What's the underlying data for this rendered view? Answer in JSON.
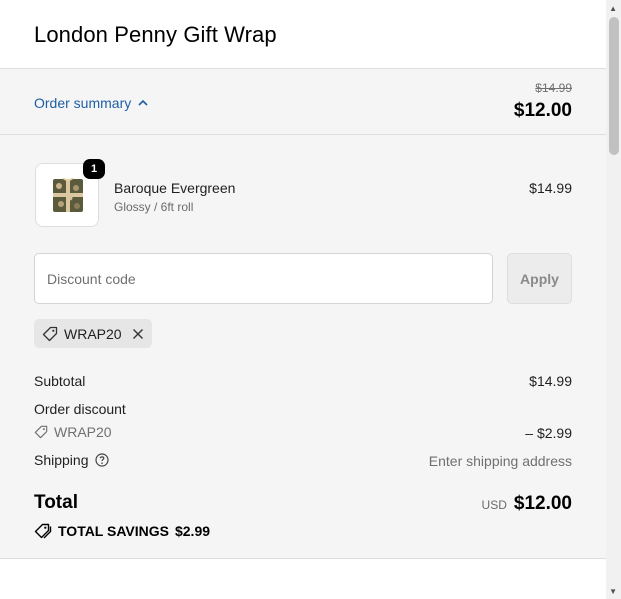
{
  "header": {
    "shop_name": "London Penny Gift Wrap"
  },
  "summary": {
    "toggle_label": "Order summary",
    "original_price": "$14.99",
    "price": "$12.00"
  },
  "product": {
    "quantity": "1",
    "name": "Baroque Evergreen",
    "variant": "Glossy / 6ft roll",
    "price": "$14.99",
    "image_icon": "gift-box-icon"
  },
  "discount": {
    "placeholder": "Discount code",
    "apply_label": "Apply",
    "applied_code": "WRAP20"
  },
  "totals": {
    "subtotal_label": "Subtotal",
    "subtotal_value": "$14.99",
    "order_discount_label": "Order discount",
    "discount_code": "WRAP20",
    "discount_value": "– $2.99",
    "shipping_label": "Shipping",
    "shipping_value": "Enter shipping address",
    "total_label": "Total",
    "currency": "USD",
    "total_value": "$12.00",
    "savings_label": "TOTAL SAVINGS",
    "savings_value": "$2.99"
  },
  "colors": {
    "link": "#1f5fa6",
    "panel_bg": "#f5f5f5",
    "badge_bg": "#000000"
  }
}
